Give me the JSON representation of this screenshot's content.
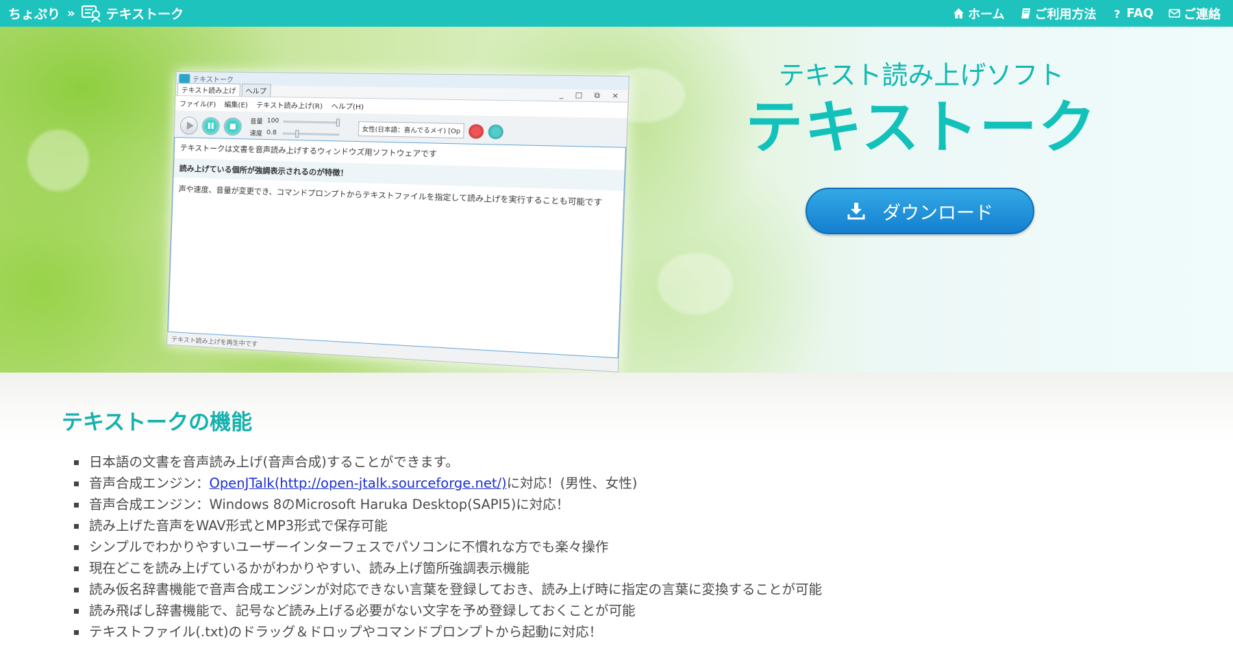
{
  "topbar": {
    "site_name": "ちょぷり",
    "separator": "»",
    "current_page": "テキストーク",
    "nav": [
      {
        "label": "ホーム",
        "icon": "home-icon"
      },
      {
        "label": "ご利用方法",
        "icon": "book-icon"
      },
      {
        "label": "FAQ",
        "icon": "question-icon"
      },
      {
        "label": "ご連絡",
        "icon": "mail-icon"
      }
    ],
    "color": "#1ec3bd"
  },
  "hero": {
    "subtitle": "テキスト読み上げソフト",
    "title": "テキストーク",
    "download_label": "ダウンロード",
    "download_icon": "download-icon",
    "accent": "#12c1ba",
    "button_color": "#1a8fd8"
  },
  "app_mock": {
    "window_title": "テキストーク",
    "tabs": [
      "テキスト読み上げ",
      "ヘルプ"
    ],
    "menu": [
      "ファイル(F)",
      "編集(E)",
      "テキスト読み上げ(R)",
      "ヘルプ(H)"
    ],
    "window_controls": "_ □ ⧉ ×",
    "volume_label": "音量",
    "volume_value": "100",
    "speed_label": "速度",
    "speed_value": "0.8",
    "voice": "女性(日本語：喜んでるメイ) [Op",
    "lines": [
      "テキストークは文書を音声読み上げするウィンドウズ用ソフトウェアです",
      "読み上げている個所が強調表示されるのが特徴！",
      "声や速度、音量が変更でき、コマンドプロンプトからテキストファイルを指定して読み上げを実行することも可能です"
    ],
    "status": "テキスト読み上げを再生中です"
  },
  "features": {
    "title": "テキストークの機能",
    "items": [
      {
        "text": "日本語の文書を音声読み上げ(音声合成)することができます。"
      },
      {
        "before": "音声合成エンジン：",
        "link": "OpenJTalk(http://open-jtalk.sourceforge.net/)",
        "after": "に対応！(男性、女性)"
      },
      {
        "text": "音声合成エンジン：Windows 8のMicrosoft Haruka Desktop(SAPI5)に対応！"
      },
      {
        "text": "読み上げた音声をWAV形式とMP3形式で保存可能"
      },
      {
        "text": "シンプルでわかりやすいユーザーインターフェスでパソコンに不慣れな方でも楽々操作"
      },
      {
        "text": "現在どこを読み上げているかがわかりやすい、読み上げ箇所強調表示機能"
      },
      {
        "text": "読み仮名辞書機能で音声合成エンジンが対応できない言葉を登録しておき、読み上げ時に指定の言葉に変換することが可能"
      },
      {
        "text": "読み飛ばし辞書機能で、記号など読み上げる必要がない文字を予め登録しておくことが可能"
      },
      {
        "text": "テキストファイル(.txt)のドラッグ＆ドロップやコマンドプロンプトから起動に対応！"
      }
    ]
  }
}
